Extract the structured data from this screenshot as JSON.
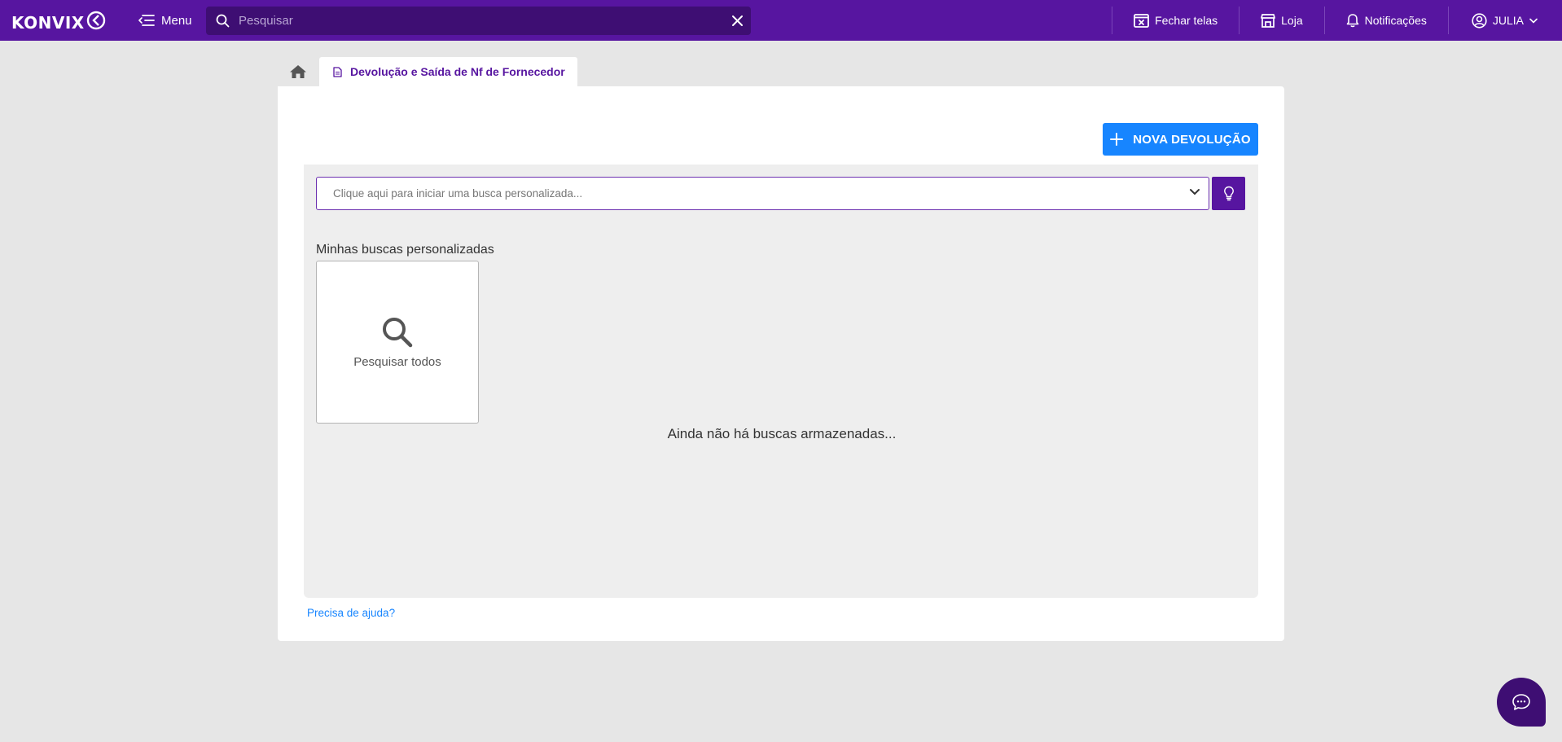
{
  "header": {
    "logo_text": "KONVIX",
    "menu_label": "Menu",
    "search": {
      "placeholder": "Pesquisar",
      "value": ""
    },
    "actions": {
      "close_screens": "Fechar telas",
      "store": "Loja",
      "notifications": "Notificações",
      "user": "JULIA"
    },
    "icons": [
      "menu-icon",
      "search-icon",
      "close-icon",
      "close-screens-icon",
      "store-icon",
      "bell-icon",
      "user-icon",
      "chevron-down-icon"
    ]
  },
  "tabs": {
    "home_icon": "home-icon",
    "active_tab_label": "Devolução e Saída de Nf de Fornecedor"
  },
  "main": {
    "new_button_label": "NOVA DEVOLUÇÃO",
    "custom_search_placeholder": "Clique aqui para iniciar uma busca personalizada...",
    "saved_searches_title": "Minhas buscas personalizadas",
    "search_all_label": "Pesquisar todos",
    "empty_message": "Ainda não há buscas armazenadas...",
    "help_link": "Precisa de ajuda?"
  },
  "colors": {
    "brand_purple": "#5715a0",
    "search_dark": "#3e0e73",
    "primary_blue": "#1785ff",
    "background": "#e6e6e6"
  }
}
